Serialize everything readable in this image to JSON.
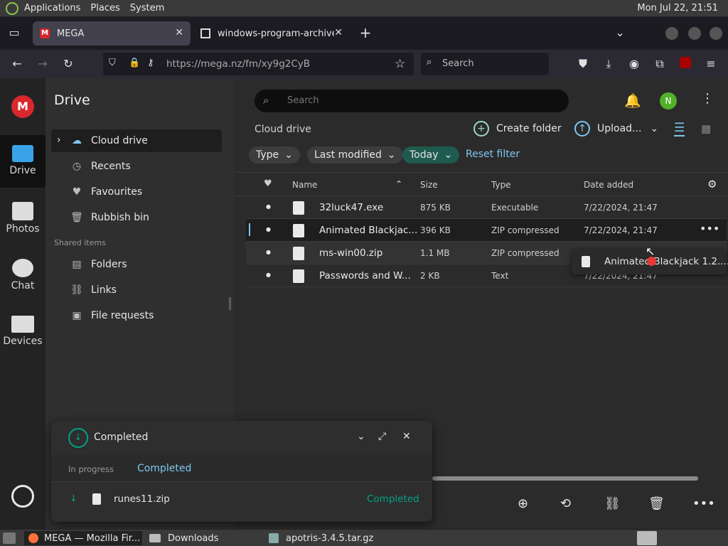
{
  "os": {
    "menus": [
      "Applications",
      "Places",
      "System"
    ],
    "clock": "Mon Jul 22, 21:51"
  },
  "browser": {
    "tabs": [
      {
        "title": "MEGA",
        "active": true
      },
      {
        "title": "windows-program-archive",
        "active": false
      }
    ],
    "url": "https://mega.nz/fm/xy9g2CyB",
    "search_placeholder": "Search"
  },
  "rail": {
    "items": [
      {
        "label": "Drive",
        "icon": "folder-icon"
      },
      {
        "label": "Photos",
        "icon": "photos-icon"
      },
      {
        "label": "Chat",
        "icon": "chat-icon"
      },
      {
        "label": "Devices",
        "icon": "devices-icon"
      }
    ]
  },
  "sidebar": {
    "title": "Drive",
    "items": [
      {
        "label": "Cloud drive",
        "icon": "cloud-icon"
      },
      {
        "label": "Recents",
        "icon": "clock-icon"
      },
      {
        "label": "Favourites",
        "icon": "heart-icon"
      },
      {
        "label": "Rubbish bin",
        "icon": "trash-icon"
      }
    ],
    "shared_heading": "Shared items",
    "shared_items": [
      {
        "label": "Folders",
        "icon": "shared-folder-icon"
      },
      {
        "label": "Links",
        "icon": "link-icon"
      },
      {
        "label": "File requests",
        "icon": "file-request-icon"
      }
    ]
  },
  "main": {
    "search_placeholder": "Search",
    "avatar_letter": "N",
    "breadcrumb": "Cloud drive",
    "create_folder": "Create folder",
    "upload": "Upload...",
    "filters": {
      "type": "Type",
      "modified": "Last modified",
      "today": "Today",
      "reset": "Reset filter"
    },
    "columns": {
      "name": "Name",
      "size": "Size",
      "type": "Type",
      "date": "Date added"
    },
    "files": [
      {
        "name": "32luck47.exe",
        "size": "875 KB",
        "type": "Executable",
        "date": "7/22/2024, 21:47"
      },
      {
        "name": "Animated Blackjac...",
        "size": "396 KB",
        "type": "ZIP compressed",
        "date": "7/22/2024, 21:47"
      },
      {
        "name": "ms-win00.zip",
        "size": "1.1 MB",
        "type": "ZIP compressed",
        "date": ""
      },
      {
        "name": "Passwords and W...",
        "size": "2 KB",
        "type": "Text",
        "date": "7/22/2024, 21:47"
      }
    ],
    "drag_label": "Animated Blackjack 1.2...."
  },
  "transfer": {
    "title": "Completed",
    "tab_in_progress": "In progress",
    "tab_completed": "Completed",
    "item_name": "runes11.zip",
    "item_status": "Completed"
  },
  "taskbar": {
    "items": [
      "MEGA — Mozilla Fir...",
      "Downloads",
      "apotris-3.4.5.tar.gz"
    ]
  },
  "colors": {
    "accent": "#00a382",
    "mega_red": "#d9272e",
    "bell": "#f5c518",
    "avatar": "#52b12b"
  }
}
